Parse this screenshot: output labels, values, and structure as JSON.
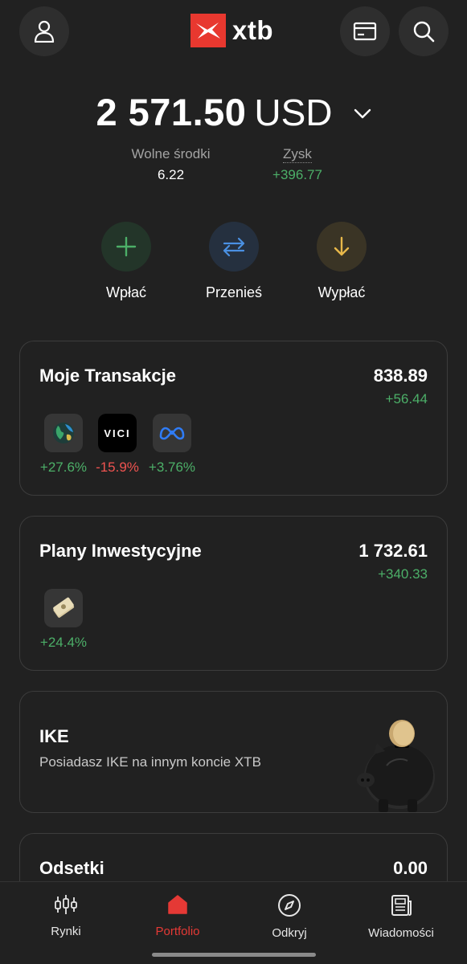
{
  "header": {
    "logo_text": "xtb",
    "account_icon": "person-icon",
    "card_icon": "card-icon",
    "search_icon": "search-icon"
  },
  "balance": {
    "amount": "2 571.50",
    "currency": "USD"
  },
  "stats": {
    "free_funds_label": "Wolne środki",
    "free_funds_value": "6.22",
    "profit_label": "Zysk",
    "profit_value": "+396.77"
  },
  "actions": [
    {
      "label": "Wpłać",
      "icon": "plus-icon",
      "color": "#4caf68"
    },
    {
      "label": "Przenieś",
      "icon": "transfer-icon",
      "color": "#4a90e2"
    },
    {
      "label": "Wypłać",
      "icon": "arrow-down-icon",
      "color": "#e8b84a"
    }
  ],
  "transactions": {
    "title": "Moje Transakcje",
    "value": "838.89",
    "delta": "+56.44",
    "assets": [
      {
        "icon": "globe-icon",
        "pct": "+27.6%"
      },
      {
        "icon": "vici-logo",
        "logo_text": "VICI",
        "pct": "-15.9%"
      },
      {
        "icon": "meta-logo-icon",
        "pct": "+3.76%"
      }
    ]
  },
  "plans": {
    "title": "Plany Inwestycyjne",
    "value": "1 732.61",
    "delta": "+340.33",
    "assets": [
      {
        "icon": "money-icon",
        "pct": "+24.4%"
      }
    ]
  },
  "ike": {
    "title": "IKE",
    "subtitle": "Posiadasz IKE na innym koncie XTB",
    "image": "piggy-bank-icon"
  },
  "interest": {
    "title": "Odsetki",
    "value": "0.00"
  },
  "nav": [
    {
      "label": "Rynki",
      "icon": "candlestick-icon"
    },
    {
      "label": "Portfolio",
      "icon": "home-icon",
      "active": true
    },
    {
      "label": "Odkryj",
      "icon": "compass-icon"
    },
    {
      "label": "Wiadomości",
      "icon": "news-icon"
    }
  ],
  "colors": {
    "background": "#212121",
    "positive": "#4caf68",
    "negative": "#ef5350",
    "brand": "#e8382f"
  }
}
